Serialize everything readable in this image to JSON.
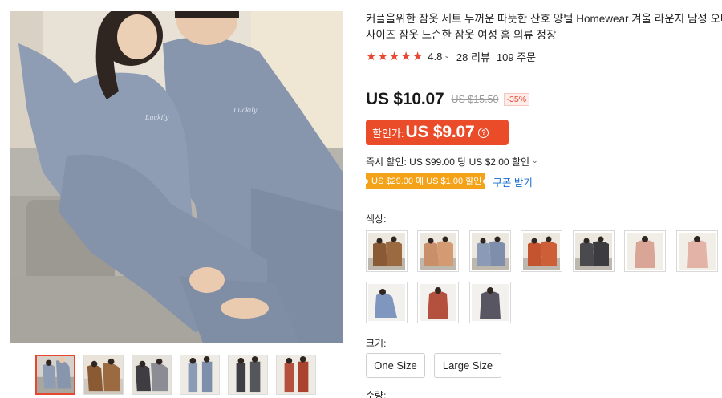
{
  "product": {
    "title": "커플을위한 잠옷 세트 두꺼운 따뜻한 산호 양털 Homewear 겨울 라운지 남성 오버사이즈 잠옷 느슨한 잠옷 여성 홈 의류 정장",
    "rating": {
      "value": "4.8",
      "reviews": "28 리뷰",
      "orders": "109 주문",
      "stars_filled": 5
    },
    "price": {
      "current": "US $10.07",
      "original": "US $15.50",
      "discount": "-35%"
    },
    "sale": {
      "label": "할인가:",
      "price": "US $9.07",
      "help_symbol": "?"
    },
    "instant_discount": "즉시 할인: US $99.00 당 US $2.00 할인",
    "coupon": {
      "tag": "US $29.00 에 US $1.00 할인",
      "link": "쿠폰 받기"
    },
    "color_label": "색상:",
    "size_label": "크기:",
    "sizes": [
      "One Size",
      "Large Size"
    ],
    "quantity_label": "수량:"
  },
  "thumbnails": [
    {
      "name": "thumb-grey-couple"
    },
    {
      "name": "thumb-brown-couple"
    },
    {
      "name": "thumb-black-grey-couple"
    },
    {
      "name": "thumb-blue-standing"
    },
    {
      "name": "thumb-dark-standing"
    },
    {
      "name": "thumb-red-standing"
    }
  ],
  "swatch_colors": [
    "#8a5a34",
    "#c98f68",
    "#8c9bb5",
    "#c4542f",
    "#4a4a4e",
    "#d8a596",
    "#e2b3a6",
    "#7f97bf",
    "#b4503e",
    "#585662"
  ],
  "colors": {
    "accent": "#e8472f",
    "sale_bg": "#ea4b28",
    "coupon_bg": "#f4a218",
    "link": "#1a6cd0"
  }
}
